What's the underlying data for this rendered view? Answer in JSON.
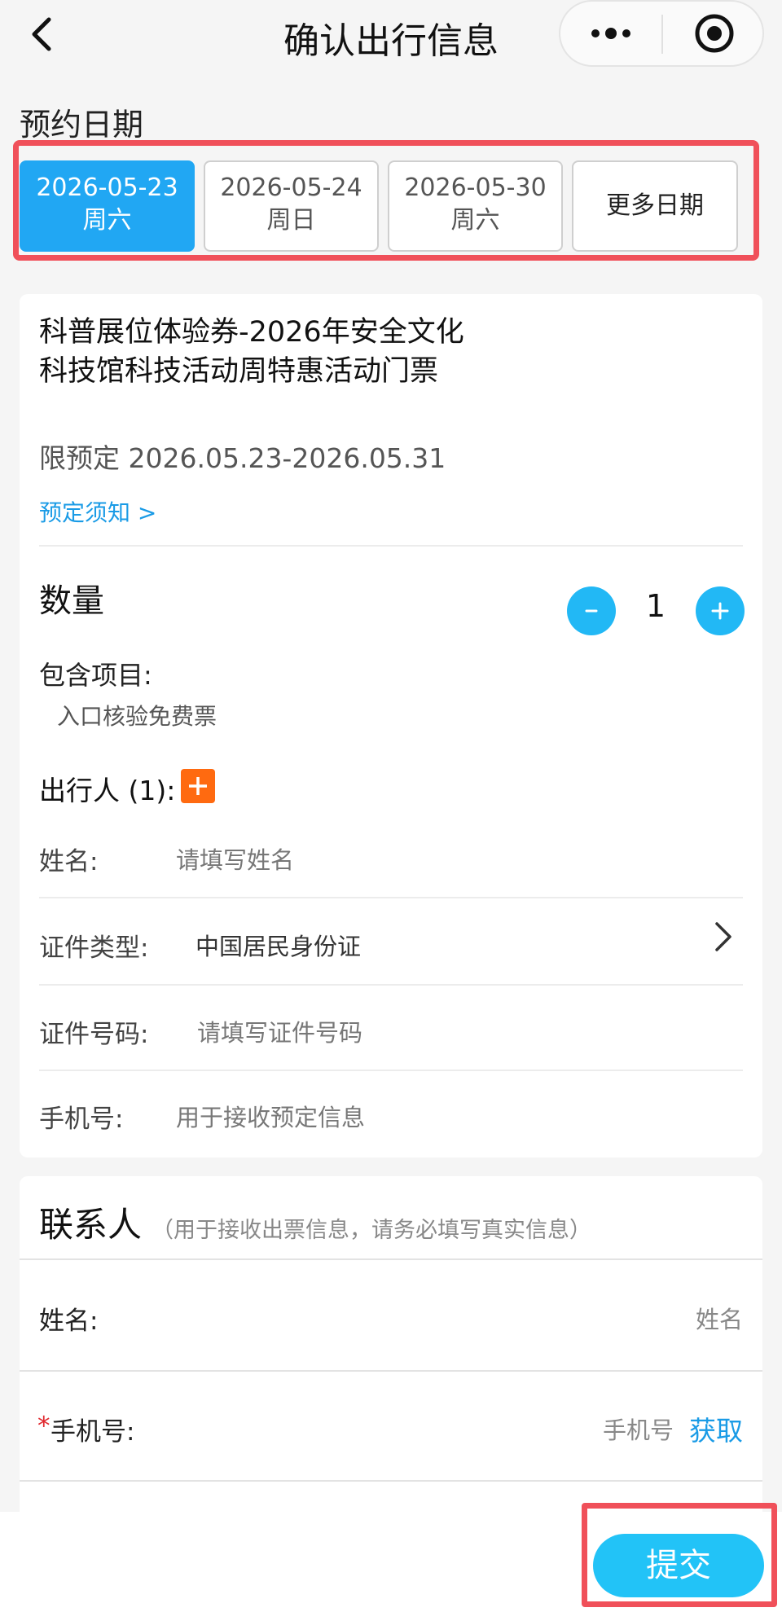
{
  "header": {
    "title": "确认出行信息"
  },
  "date_section": {
    "title": "预约日期",
    "dates": [
      {
        "date": "2026-05-23",
        "weekday": "周六",
        "selected": true
      },
      {
        "date": "2026-05-24",
        "weekday": "周日",
        "selected": false
      },
      {
        "date": "2026-05-30",
        "weekday": "周六",
        "selected": false
      }
    ],
    "more_label": "更多日期"
  },
  "ticket": {
    "title": "科普展位体验券-2026年安全文化科技馆科技活动周特惠活动门票",
    "limit": "限预定 2026.05.23-2026.05.31",
    "notice_link": "预定须知 >"
  },
  "quantity": {
    "label": "数量",
    "value": "1",
    "minus": "−",
    "plus": "+"
  },
  "includes": {
    "label": "包含项目:",
    "item": "入口核验免费票"
  },
  "traveler": {
    "label": "出行人 (1):",
    "add": "+",
    "name_label": "姓名:",
    "name_placeholder": "请填写姓名",
    "id_type_label": "证件类型:",
    "id_type_value": "中国居民身份证",
    "id_number_label": "证件号码:",
    "id_number_placeholder": "请填写证件号码",
    "phone_label": "手机号:",
    "phone_placeholder": "用于接收预定信息"
  },
  "contact": {
    "title": "联系人",
    "hint": "（用于接收出票信息，请务必填写真实信息）",
    "name_label": "姓名:",
    "name_placeholder": "姓名",
    "phone_required": "*",
    "phone_label": "手机号:",
    "phone_placeholder": "手机号",
    "fetch_label": "获取"
  },
  "submit_label": "提交",
  "colors": {
    "accent": "#21a7f3",
    "highlight": "#f0505a",
    "add_orange": "#ff6a10",
    "submit": "#22c3f7"
  }
}
